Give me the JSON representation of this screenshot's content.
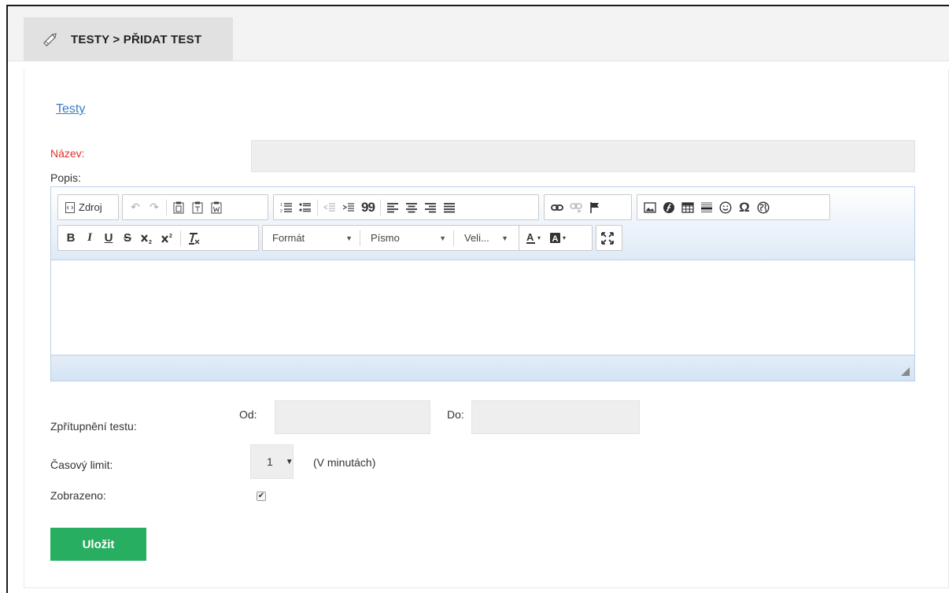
{
  "header": {
    "tab_title": "TESTY > PŘIDAT TEST",
    "tab_icon": "pencil-icon"
  },
  "breadcrumb": {
    "back_link": "Testy"
  },
  "form": {
    "name_label": "Název:",
    "name_value": "",
    "description_label": "Popis:",
    "availability_label": "Zpřítupnění testu:",
    "from_label": "Od:",
    "from_value": "",
    "to_label": "Do:",
    "to_value": "",
    "time_limit_label": "Časový limit:",
    "time_limit_value": "1",
    "time_limit_unit": "(V minutách)",
    "displayed_label": "Zobrazeno:",
    "displayed_checked": true,
    "save_label": "Uložit"
  },
  "editor": {
    "source_label": "Zdroj",
    "format_label": "Formát",
    "font_label": "Písmo",
    "size_label": "Veli...",
    "bold_label": "B",
    "italic_label": "I",
    "underline_label": "U",
    "strike_label": "S",
    "quote_label": "99",
    "special_char_label": "Ω",
    "content": ""
  },
  "colors": {
    "required_label": "#e0312b",
    "link": "#3a7fbf",
    "save_button": "#27ae60",
    "tab_background": "#e1e1e1"
  }
}
